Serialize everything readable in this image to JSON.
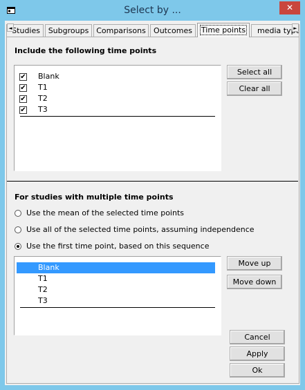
{
  "window": {
    "title": "Select by ...",
    "close_label": "✕",
    "app_icon": "window-icon"
  },
  "tabs": [
    {
      "label": "Studies",
      "active": false
    },
    {
      "label": "Subgroups",
      "active": false
    },
    {
      "label": "Comparisons",
      "active": false
    },
    {
      "label": "Outcomes",
      "active": false
    },
    {
      "label": "Time points",
      "active": true
    },
    {
      "label": "media type",
      "active": false
    }
  ],
  "tab_scroll": {
    "left": "◄",
    "right": "►"
  },
  "include_section": {
    "heading": "Include the following time points",
    "items": [
      {
        "label": "Blank",
        "checked": true
      },
      {
        "label": "T1",
        "checked": true
      },
      {
        "label": "T2",
        "checked": true
      },
      {
        "label": "T3",
        "checked": true
      }
    ],
    "select_all": "Select all",
    "clear_all": "Clear all"
  },
  "multiple_section": {
    "heading": "For studies with multiple time points",
    "options": [
      {
        "label": "Use the mean of the selected time points",
        "selected": false
      },
      {
        "label": "Use all of the selected time points, assuming independence",
        "selected": false
      },
      {
        "label": "Use the first time point, based on this sequence",
        "selected": true
      }
    ],
    "sequence": [
      {
        "label": "Blank",
        "selected": true
      },
      {
        "label": "T1",
        "selected": false
      },
      {
        "label": "T2",
        "selected": false
      },
      {
        "label": "T3",
        "selected": false
      }
    ],
    "move_up": "Move up",
    "move_down": "Move down"
  },
  "footer": {
    "cancel": "Cancel",
    "apply": "Apply",
    "ok": "Ok"
  },
  "colors": {
    "frame": "#7ec8ea",
    "close": "#c9463d",
    "selection": "#3399ff"
  }
}
